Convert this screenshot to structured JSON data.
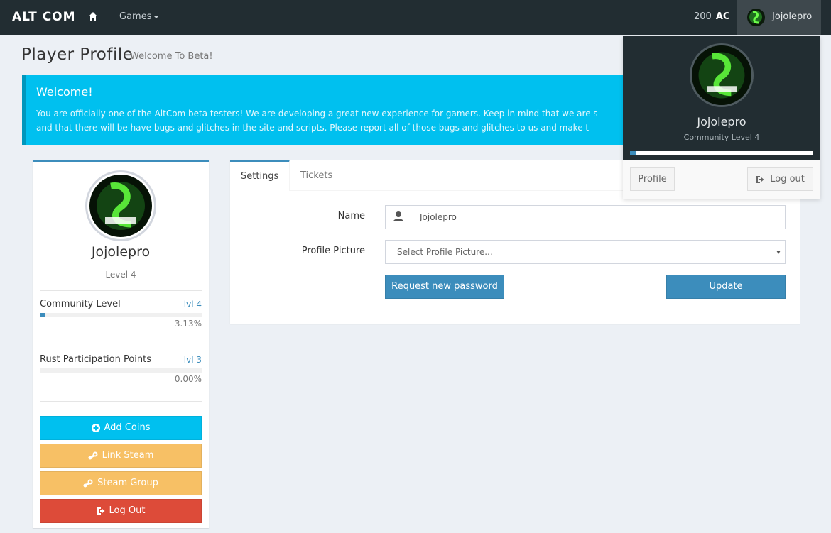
{
  "navbar": {
    "brand": "ALT COM",
    "home_icon": "home-icon",
    "games_label": "Games",
    "coins_amount": "200",
    "coins_unit": "AC",
    "username": "Jojolepro"
  },
  "page": {
    "title": "Player Profile",
    "subtitle": "Welcome To Beta!"
  },
  "callout": {
    "title": "Welcome!",
    "line1": "You are officially one of the AltCom beta testers! We are developing a great new experience for gamers. Keep in mind that we are s",
    "line2": "and that there will be have bugs and glitches in the site and scripts. Please report all of those bugs and glitches to us and make t"
  },
  "profile": {
    "name": "Jojolepro",
    "level": "Level 4",
    "stats": [
      {
        "label": "Community Level",
        "lvl": "lvl 4",
        "pct": "3.13%",
        "fill": 3.13
      },
      {
        "label": "Rust Participation Points",
        "lvl": "lvl 3",
        "pct": "0.00%",
        "fill": 0
      }
    ],
    "buttons": {
      "add_coins": "Add Coins",
      "link_steam": "Link Steam",
      "steam_group": "Steam Group",
      "log_out": "Log Out"
    }
  },
  "settings": {
    "tabs": [
      "Settings",
      "Tickets"
    ],
    "name_label": "Name",
    "name_value": "Jojolepro",
    "picture_label": "Profile Picture",
    "picture_placeholder": "Select Profile Picture...",
    "request_password": "Request new password",
    "update": "Update"
  },
  "dropdown": {
    "name": "Jojolepro",
    "level": "Community Level 4",
    "progress_fill": 3.13,
    "profile_btn": "Profile",
    "logout_btn": "Log out"
  },
  "colors": {
    "primary": "#3c8dbc",
    "aqua": "#00c0ef",
    "warning": "#f7c065",
    "danger": "#dd4b39",
    "navbar": "#222d32"
  }
}
